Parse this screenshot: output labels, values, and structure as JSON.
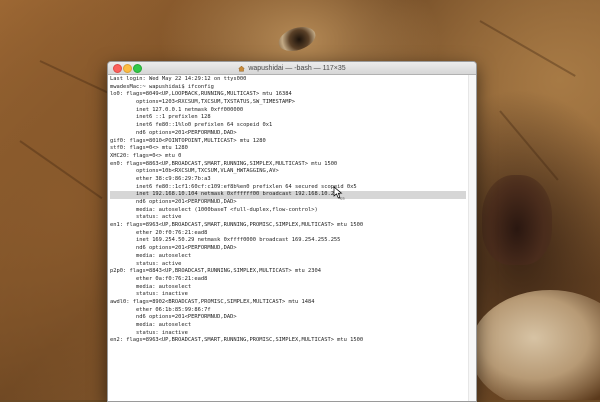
{
  "window": {
    "title": "wapushidai — -bash — 117×35"
  },
  "terminal": {
    "lines": [
      "Last login: Wed May 22 14:29:12 on ttys000",
      "mwadesMac:~ wapushidai$ ifconfig",
      "lo0: flags=8049<UP,LOOPBACK,RUNNING,MULTICAST> mtu 16384",
      "        options=1203<RXCSUM,TXCSUM,TXSTATUS,SW_TIMESTAMP>",
      "        inet 127.0.0.1 netmask 0xff000000",
      "        inet6 ::1 prefixlen 128",
      "        inet6 fe80::1%lo0 prefixlen 64 scopeid 0x1",
      "        nd6 options=201<PERFORMNUD,DAD>",
      "gif0: flags=8010<POINTOPOINT,MULTICAST> mtu 1280",
      "stf0: flags=0<> mtu 1280",
      "XHC20: flags=0<> mtu 0",
      "en0: flags=8863<UP,BROADCAST,SMART,RUNNING,SIMPLEX,MULTICAST> mtu 1500",
      "        options=10b<RXCSUM,TXCSUM,VLAN_HWTAGGING,AV>",
      "        ether 38:c9:86:29:7b:a3",
      "        inet6 fe80::1cf1:60cf:c109:ef8b%en0 prefixlen 64 secured scopeid 0x5",
      "        inet 192.168.10.104 netmask 0xffffff00 broadcast 192.168.10.255",
      "        nd6 options=201<PERFORMNUD,DAD>",
      "        media: autoselect (1000baseT <full-duplex,flow-control>)",
      "        status: active",
      "en1: flags=8963<UP,BROADCAST,SMART,RUNNING,PROMISC,SIMPLEX,MULTICAST> mtu 1500",
      "        ether 20:f0:76:21:ead8",
      "        inet 169.254.50.29 netmask 0xffff0000 broadcast 169.254.255.255",
      "        nd6 options=201<PERFORMNUD,DAD>",
      "        media: autoselect",
      "        status: active",
      "p2p0: flags=8843<UP,BROADCAST,RUNNING,SIMPLEX,MULTICAST> mtu 2304",
      "        ether 0a:f0:76:21:ead8",
      "        media: autoselect",
      "        status: inactive",
      "awdl0: flags=8902<BROADCAST,PROMISC,SIMPLEX,MULTICAST> mtu 1484",
      "        ether 06:1b:85:99:86:7f",
      "        nd6 options=201<PERFORMNUD,DAD>",
      "        media: autoselect",
      "        status: inactive",
      "en2: flags=8963<UP,BROADCAST,SMART,RUNNING,PROMISC,SIMPLEX,MULTICAST> mtu 1500"
    ],
    "highlighted_line_index": 15
  },
  "cursor": {
    "icon": "pointer-cursor-icon",
    "label": "425\n25"
  },
  "colors": {
    "close": "#fc605c",
    "minimize": "#fdbc40",
    "maximize": "#34c84a",
    "selection": "#d6d6d6"
  }
}
